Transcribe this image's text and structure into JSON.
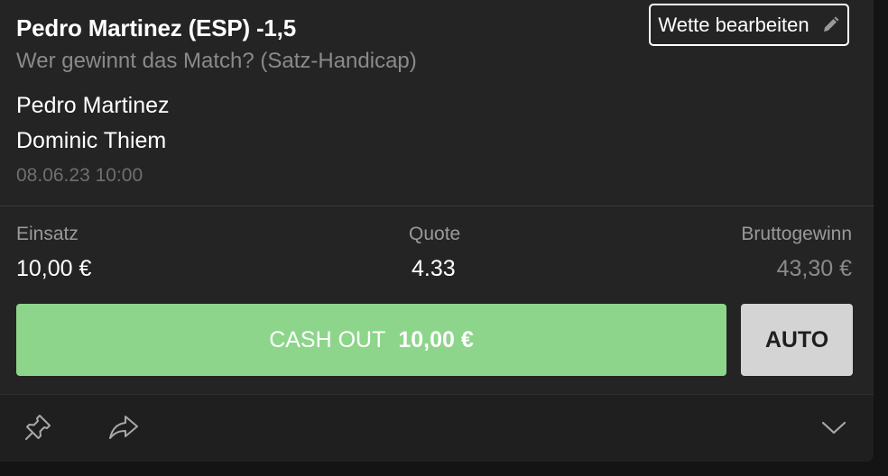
{
  "bet": {
    "title": "Pedro Martinez (ESP) -1,5",
    "subtitle": "Wer gewinnt das Match? (Satz-Handicap)",
    "edit_label": "Wette bearbeiten",
    "edit_icon": "pencil-icon",
    "players": [
      "Pedro Martinez",
      "Dominic Thiem"
    ],
    "date": "08.06.23 10:00"
  },
  "stats": {
    "stake_label": "Einsatz",
    "stake_value": "10,00 €",
    "odds_label": "Quote",
    "odds_value": "4.33",
    "payout_label": "Bruttogewinn",
    "payout_value": "43,30 €"
  },
  "actions": {
    "cashout_label": "CASH OUT",
    "cashout_amount": "10,00 €",
    "auto_label": "AUTO"
  },
  "footer": {
    "icons": [
      "pin-icon",
      "share-icon",
      "chevron-down-icon"
    ]
  },
  "colors": {
    "card_bg": "#242424",
    "cashout_green": "#8dd58a",
    "auto_gray": "#d4d4d4",
    "muted_text": "#8a8a8a"
  }
}
